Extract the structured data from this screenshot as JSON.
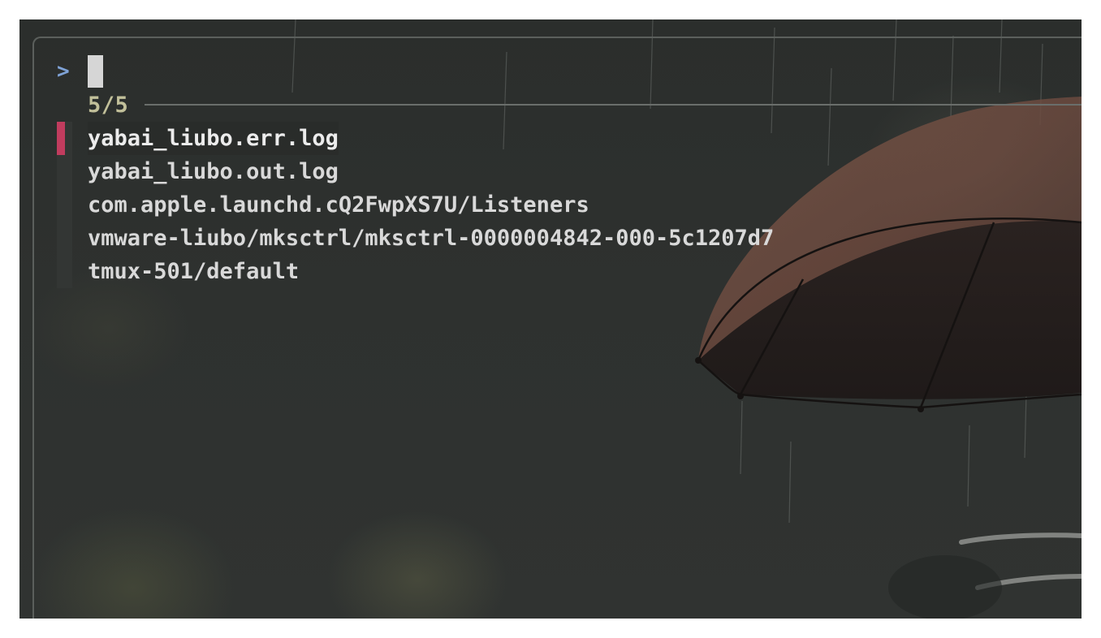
{
  "prompt": {
    "symbol": ">",
    "query": ""
  },
  "info": {
    "match_count": "5/5"
  },
  "results": [
    {
      "text": "yabai_liubo.err.log",
      "selected": true
    },
    {
      "text": "yabai_liubo.out.log",
      "selected": false
    },
    {
      "text": "com.apple.launchd.cQ2FwpXS7U/Listeners",
      "selected": false
    },
    {
      "text": "vmware-liubo/mksctrl/mksctrl-0000004842-000-5c1207d7",
      "selected": false
    },
    {
      "text": "tmux-501/default",
      "selected": false
    }
  ],
  "colors": {
    "prompt": "#7fa2d6",
    "match_count": "#c2c09a",
    "selection_marker": "#c13c5e",
    "text": "#d9d9d9",
    "background": "#2e312f"
  },
  "icons": {
    "cursor": "block-cursor"
  }
}
